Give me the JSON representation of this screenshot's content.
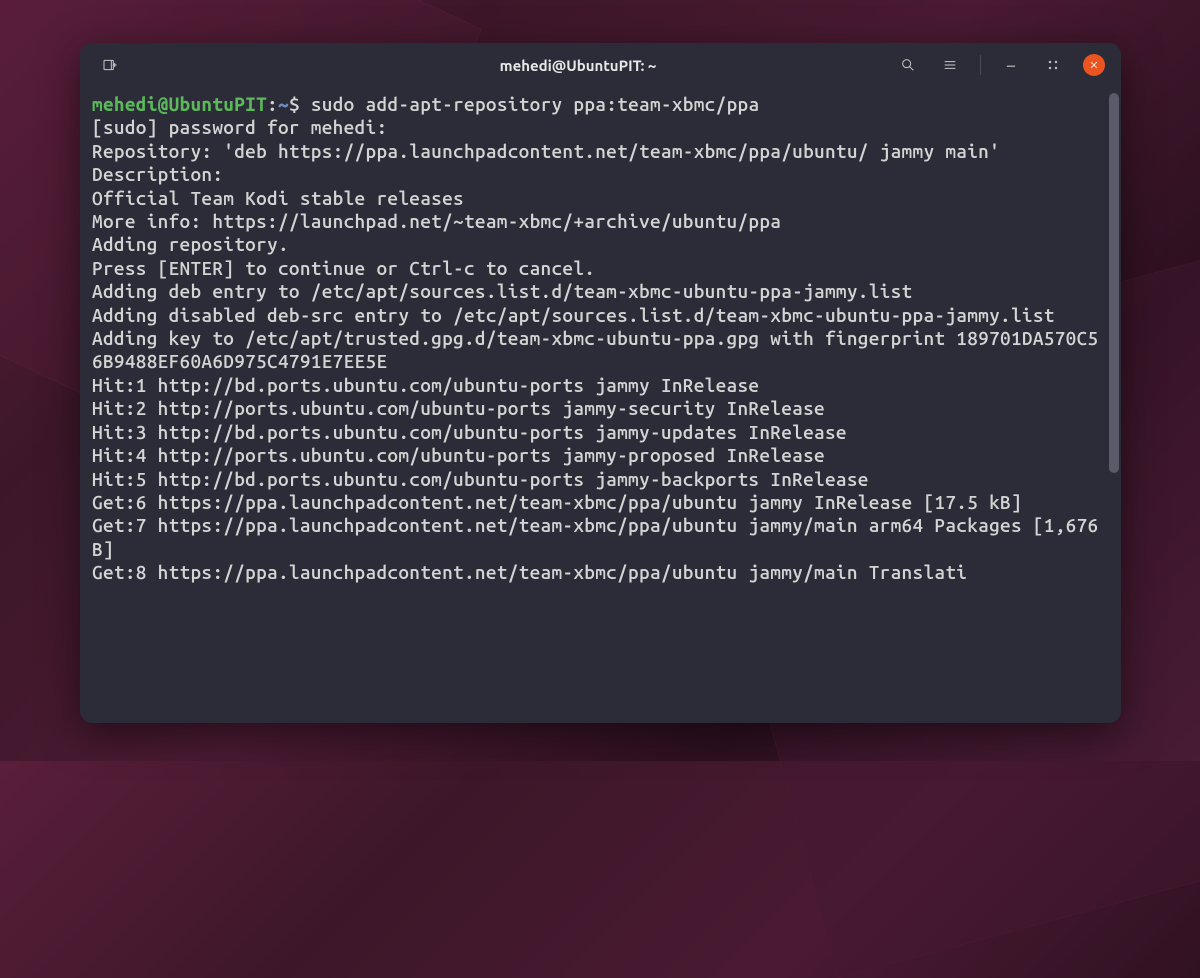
{
  "titlebar": {
    "title": "mehedi@UbuntuPIT: ~"
  },
  "prompt": {
    "user_host": "mehedi@UbuntuPIT",
    "sep1": ":",
    "path": "~",
    "sep2": "$ "
  },
  "command": "sudo add-apt-repository ppa:team-xbmc/ppa",
  "output_lines": [
    "[sudo] password for mehedi: ",
    "Repository: 'deb https://ppa.launchpadcontent.net/team-xbmc/ppa/ubuntu/ jammy main'",
    "Description:",
    "Official Team Kodi stable releases",
    "More info: https://launchpad.net/~team-xbmc/+archive/ubuntu/ppa",
    "Adding repository.",
    "Press [ENTER] to continue or Ctrl-c to cancel.",
    "Adding deb entry to /etc/apt/sources.list.d/team-xbmc-ubuntu-ppa-jammy.list",
    "Adding disabled deb-src entry to /etc/apt/sources.list.d/team-xbmc-ubuntu-ppa-jammy.list",
    "Adding key to /etc/apt/trusted.gpg.d/team-xbmc-ubuntu-ppa.gpg with fingerprint 189701DA570C56B9488EF60A6D975C4791E7EE5E",
    "Hit:1 http://bd.ports.ubuntu.com/ubuntu-ports jammy InRelease",
    "Hit:2 http://ports.ubuntu.com/ubuntu-ports jammy-security InRelease",
    "Hit:3 http://bd.ports.ubuntu.com/ubuntu-ports jammy-updates InRelease",
    "Hit:4 http://ports.ubuntu.com/ubuntu-ports jammy-proposed InRelease",
    "Hit:5 http://bd.ports.ubuntu.com/ubuntu-ports jammy-backports InRelease",
    "Get:6 https://ppa.launchpadcontent.net/team-xbmc/ppa/ubuntu jammy InRelease [17.5 kB]",
    "Get:7 https://ppa.launchpadcontent.net/team-xbmc/ppa/ubuntu jammy/main arm64 Packages [1,676 B]",
    "Get:8 https://ppa.launchpadcontent.net/team-xbmc/ppa/ubuntu jammy/main Translati"
  ]
}
